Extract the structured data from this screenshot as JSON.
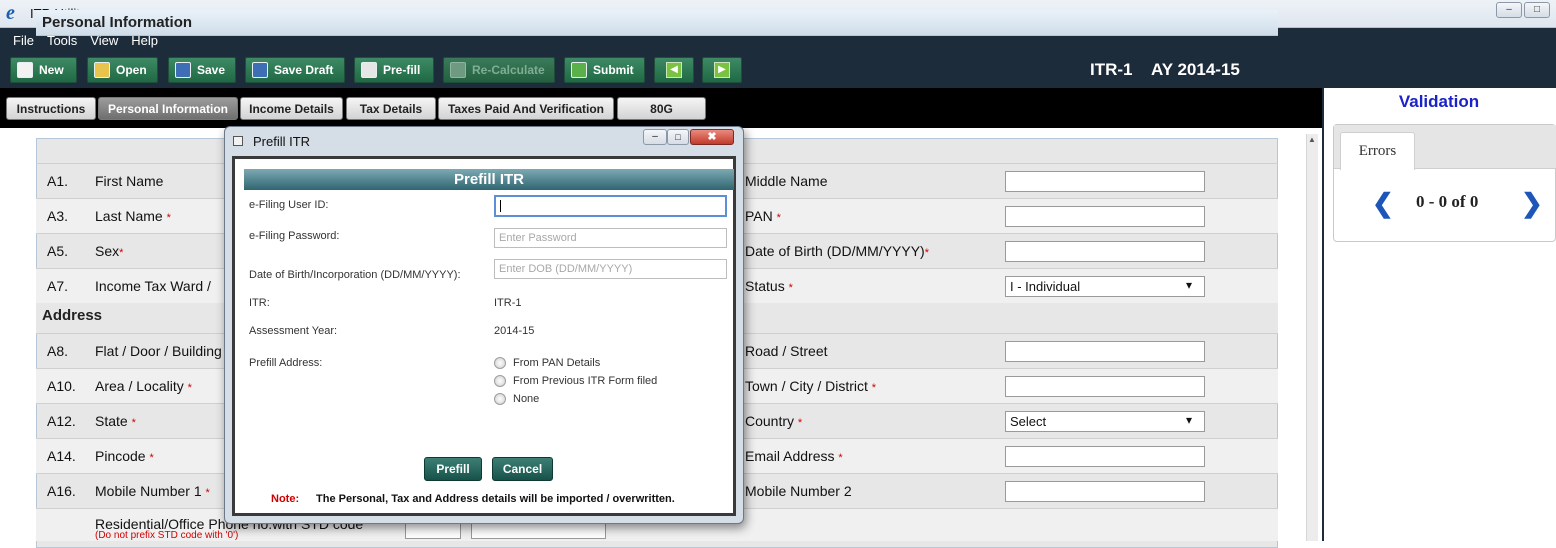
{
  "window": {
    "title": "ITR Utility",
    "logo_letter": "e"
  },
  "menu": [
    "File",
    "Tools",
    "View",
    "Help"
  ],
  "toolbar": {
    "new": "New",
    "open": "Open",
    "save": "Save",
    "save_draft": "Save Draft",
    "prefill": "Pre-fill",
    "recalculate": "Re-Calculate",
    "submit": "Submit",
    "form_id": "ITR-1",
    "assessment_year": "AY 2014-15"
  },
  "tabs": [
    "Instructions",
    "Personal Information",
    "Income Details",
    "Tax Details",
    "Taxes Paid And Verification",
    "80G"
  ],
  "form": {
    "section_personal": "Personal Information",
    "section_address": "Address",
    "rows": [
      {
        "num": "A1.",
        "left": "First Name",
        "left_req": "",
        "right": "Middle Name",
        "right_req": "",
        "right_value": ""
      },
      {
        "num": "A3.",
        "left": "Last Name",
        "left_req": "*",
        "right": "PAN",
        "right_req": "*",
        "right_value": ""
      },
      {
        "num": "A5.",
        "left": "Sex",
        "left_req": "*",
        "right": "Date of Birth (DD/MM/YYYY)",
        "right_req": "*",
        "right_value": ""
      },
      {
        "num": "A7.",
        "left": "Income Tax Ward /",
        "left_req": "",
        "right": "Status",
        "right_req": "*",
        "right_value": "I - Individual"
      },
      {
        "num": "A8.",
        "left": "Flat / Door / Building",
        "left_req": "",
        "right": "Road / Street",
        "right_req": "",
        "right_value": ""
      },
      {
        "num": "A10.",
        "left": "Area / Locality",
        "left_req": "*",
        "right": "Town / City / District",
        "right_req": "*",
        "right_value": ""
      },
      {
        "num": "A12.",
        "left": "State",
        "left_req": "*",
        "right": "Country",
        "right_req": "*",
        "right_value": "Select"
      },
      {
        "num": "A14.",
        "left": "Pincode",
        "left_req": "*",
        "right": "Email Address",
        "right_req": "*",
        "right_value": ""
      },
      {
        "num": "A16.",
        "left": "Mobile Number 1",
        "left_req": "*",
        "right": "Mobile Number 2",
        "right_req": "",
        "right_value": ""
      }
    ],
    "phone_label": "Residential/Office Phone no.with STD code",
    "phone_note": "(Do not prefix STD code with '0')"
  },
  "validation": {
    "title": "Validation",
    "tab": "Errors",
    "count": "0 - 0 of 0",
    "prev_icon": "❮",
    "next_icon": "❯"
  },
  "dialog": {
    "window_title": "Prefill ITR",
    "header": "Prefill ITR",
    "user_id_label": "e-Filing User ID:",
    "user_id_value": "",
    "password_label": "e-Filing Password:",
    "password_placeholder": "Enter Password",
    "dob_label": "Date of Birth/Incorporation  (DD/MM/YYYY):",
    "dob_placeholder": "Enter DOB (DD/MM/YYYY)",
    "itr_label": "ITR:",
    "itr_value": "ITR-1",
    "ay_label": "Assessment Year:",
    "ay_value": "2014-15",
    "address_label": "Prefill Address:",
    "address_options": [
      "From PAN Details",
      "From Previous ITR Form filed",
      "None"
    ],
    "prefill_button": "Prefill",
    "cancel_button": "Cancel",
    "note_prefix": "Note:",
    "note_text": "The Personal, Tax and Address details will be imported / overwritten."
  }
}
